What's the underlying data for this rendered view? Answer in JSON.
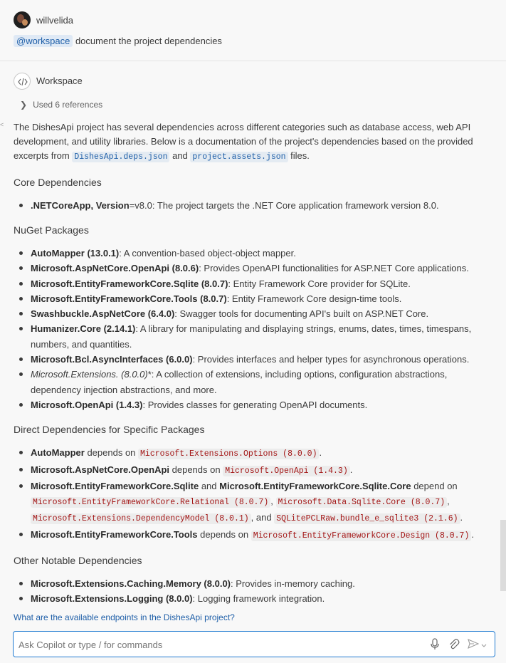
{
  "user": {
    "name": "willvelida",
    "mention": "@workspace",
    "prompt": " document the project dependencies"
  },
  "response": {
    "agent": "Workspace",
    "references": "Used 6 references",
    "intro_a": "The DishesApi project has several dependencies across different categories such as database access, web API development, and utility libraries. Below is a documentation of the project's dependencies based on the provided excerpts from ",
    "intro_file1": "DishesApi.deps.json",
    "intro_and": " and ",
    "intro_file2": "project.assets.json",
    "intro_end": " files.",
    "sections": {
      "core": {
        "title": "Core Dependencies",
        "items": [
          {
            "name": ".NETCoreApp, Version",
            "extra": "=v8.0",
            "desc": ": The project targets the .NET Core application framework version 8.0."
          }
        ]
      },
      "nuget": {
        "title": "NuGet Packages",
        "items": [
          {
            "name": "AutoMapper (13.0.1)",
            "desc": ": A convention-based object-object mapper."
          },
          {
            "name": "Microsoft.AspNetCore.OpenApi (8.0.6)",
            "desc": ": Provides OpenAPI functionalities for ASP.NET Core applications."
          },
          {
            "name": "Microsoft.EntityFrameworkCore.Sqlite (8.0.7)",
            "desc": ": Entity Framework Core provider for SQLite."
          },
          {
            "name": "Microsoft.EntityFrameworkCore.Tools (8.0.7)",
            "desc": ": Entity Framework Core design-time tools."
          },
          {
            "name": "Swashbuckle.AspNetCore (6.4.0)",
            "desc": ": Swagger tools for documenting API's built on ASP.NET Core."
          },
          {
            "name": "Humanizer.Core (2.14.1)",
            "desc": ": A library for manipulating and displaying strings, enums, dates, times, timespans, numbers, and quantities."
          },
          {
            "name": "Microsoft.Bcl.AsyncInterfaces (6.0.0)",
            "desc": ": Provides interfaces and helper types for asynchronous operations."
          },
          {
            "name": "Microsoft.Extensions. (8.0.0)",
            "desc": "*: A collection of extensions, including options, configuration abstractions, dependency injection abstractions, and more."
          },
          {
            "name": "Microsoft.OpenApi (1.4.3)",
            "desc": ": Provides classes for generating OpenAPI documents."
          }
        ]
      },
      "direct": {
        "title": "Direct Dependencies for Specific Packages",
        "automapper": {
          "name": "AutoMapper",
          "mid": " depends on ",
          "dep": "Microsoft.Extensions.Options (8.0.0)",
          "end": "."
        },
        "openapi": {
          "name": "Microsoft.AspNetCore.OpenApi",
          "mid": " depends on ",
          "dep": "Microsoft.OpenApi (1.4.3)",
          "end": "."
        },
        "sqlite": {
          "name1": "Microsoft.EntityFrameworkCore.Sqlite",
          "and": " and ",
          "name2": "Microsoft.EntityFrameworkCore.Sqlite.Core",
          "mid": " depend on",
          "dep1": "Microsoft.EntityFrameworkCore.Relational (8.0.7)",
          "sep1": ", ",
          "dep2": "Microsoft.Data.Sqlite.Core (8.0.7)",
          "sep2": ",",
          "dep3": "Microsoft.Extensions.DependencyModel (8.0.1)",
          "sep3": ", and ",
          "dep4": "SQLitePCLRaw.bundle_e_sqlite3 (2.1.6)",
          "end": "."
        },
        "tools": {
          "name": "Microsoft.EntityFrameworkCore.Tools",
          "mid": " depends on ",
          "dep": "Microsoft.EntityFrameworkCore.Design (8.0.7)",
          "end": "."
        }
      },
      "other": {
        "title": "Other Notable Dependencies",
        "items": [
          {
            "name": "Microsoft.Extensions.Caching.Memory (8.0.0)",
            "desc": ": Provides in-memory caching."
          },
          {
            "name": "Microsoft.Extensions.Logging (8.0.0)",
            "desc": ": Logging framework integration."
          }
        ]
      }
    }
  },
  "suggestion": "What are the available endpoints in the DishesApi project?",
  "input": {
    "placeholder": "Ask Copilot or type / for commands"
  },
  "colors": {
    "link": "#1f5fa8",
    "code_red": "#a31515",
    "focus_border": "#1f7ad1"
  }
}
